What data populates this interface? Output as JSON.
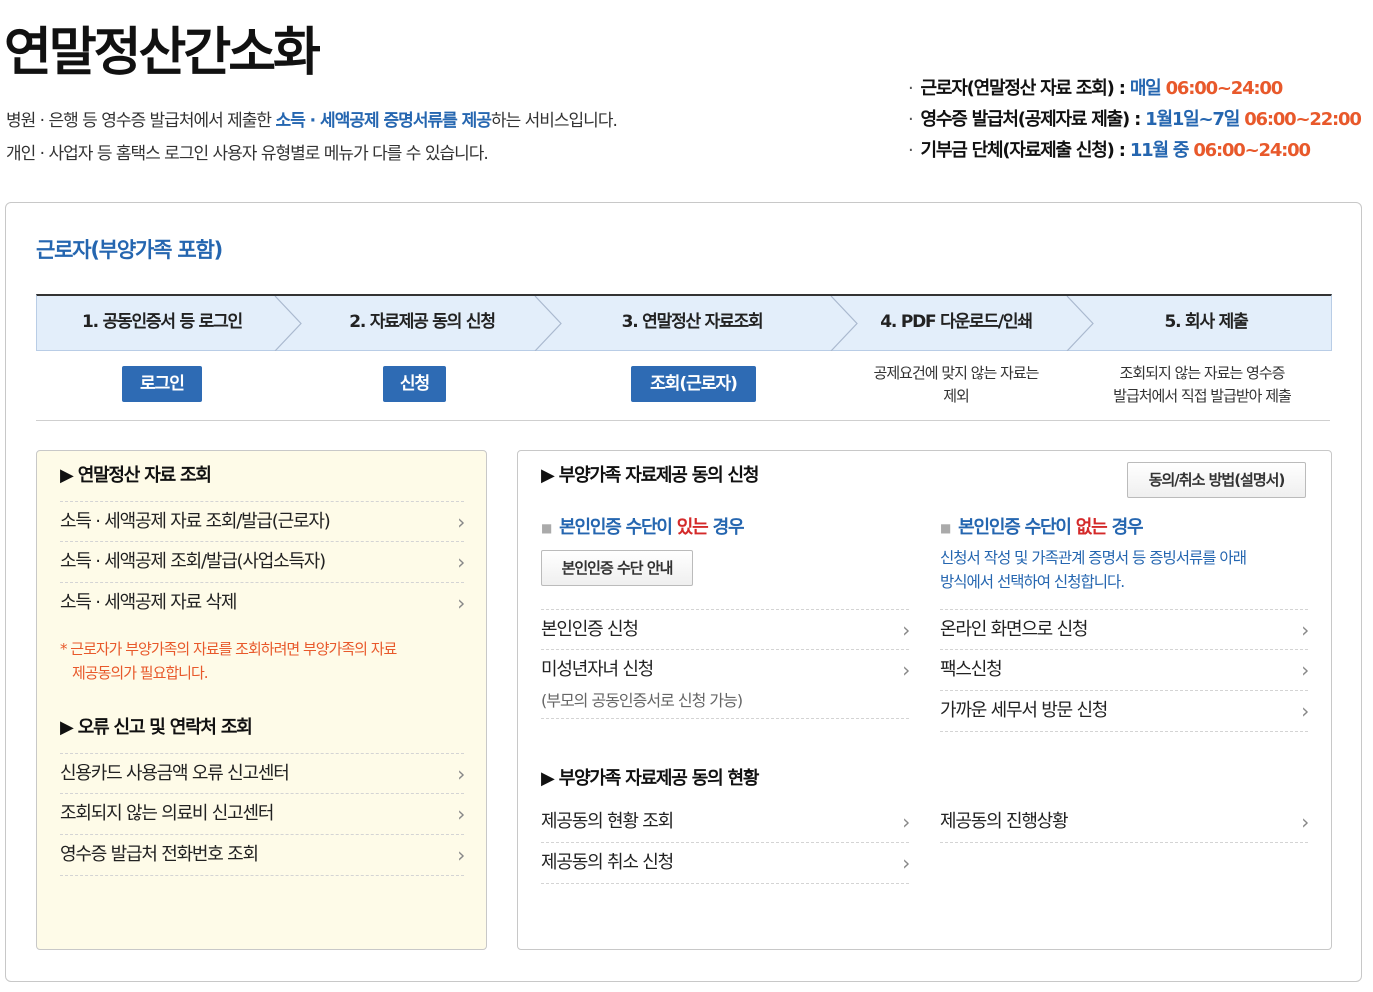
{
  "header": {
    "title": "연말정산간소화",
    "desc1_pre": "병원 · 은행 등 영수증 발급처에서 제출한 ",
    "desc1_hl": "소득 · 세액공제 증명서류를 제공",
    "desc1_post": "하는 서비스입니다.",
    "desc2": "개인 · 사업자 등 홈택스 로그인 사용자 유형별로 메뉴가 다를 수 있습니다."
  },
  "schedule": [
    {
      "label": "근로자(연말정산 자료 조회) : ",
      "period": "매일 ",
      "time": "06:00~24:00"
    },
    {
      "label": "영수증 발급처(공제자료 제출) : ",
      "period": "1월1일~7일 ",
      "time": "06:00~22:00"
    },
    {
      "label": "기부금 단체(자료제출 신청) : ",
      "period": "11월 중 ",
      "time": "06:00~24:00"
    }
  ],
  "panel": {
    "title": "근로자(부양가족 포함)",
    "steps": [
      "1. 공동인증서 등 로그인",
      "2. 자료제공 동의 신청",
      "3. 연말정산 자료조회",
      "4. PDF 다운로드/인쇄",
      "5. 회사 제출"
    ],
    "step_buttons": {
      "login": "로그인",
      "apply": "신청",
      "query": "조회(근로자)"
    },
    "step_notes": {
      "pdf": [
        "공제요건에 맞지 않는 자료는",
        "제외"
      ],
      "submit": [
        "조회되지 않는 자료는 영수증",
        "발급처에서 직접 발급받아 제출"
      ]
    }
  },
  "left": {
    "sec1_title": "▶ 연말정산 자료 조회",
    "sec1_items": [
      "소득 · 세액공제 자료 조회/발급(근로자)",
      "소득 · 세액공제 조회/발급(사업소득자)",
      "소득 · 세액공제 자료 삭제"
    ],
    "warning": [
      "* 근로자가 부양가족의 자료를 조회하려면 부양가족의 자료",
      "제공동의가 필요합니다."
    ],
    "sec2_title": "▶ 오류 신고 및 연락처 조회",
    "sec2_items": [
      "신용카드 사용금액 오류 신고센터",
      "조회되지 않는 의료비 신고센터",
      "영수증 발급처 전화번호 조회"
    ]
  },
  "right": {
    "sec1_title": "▶ 부양가족 자료제공 동의 신청",
    "guide_button": "동의/취소 방법(설명서)",
    "has_auth": {
      "pre": "본인인증 수단이 ",
      "hl": "있는",
      "post": " 경우",
      "button": "본인인증 수단 안내",
      "items": [
        "본인인증 신청",
        "미성년자녀 신청"
      ],
      "sub_note": "(부모의 공동인증서로 신청 가능)"
    },
    "no_auth": {
      "pre": "본인인증 수단이 ",
      "hl": "없는",
      "post": " 경우",
      "desc": [
        "신청서 작성 및 가족관계 증명서 등 증빙서류를 아래",
        "방식에서 선택하여 신청합니다."
      ],
      "items": [
        "온라인 화면으로 신청",
        "팩스신청",
        "가까운 세무서 방문 신청"
      ]
    },
    "sec2_title": "▶ 부양가족 자료제공 동의 현황",
    "status_left": [
      "제공동의 현황 조회",
      "제공동의 취소 신청"
    ],
    "status_right": [
      "제공동의 진행상황"
    ]
  },
  "colors": {
    "accent": "#2566b0",
    "orange": "#e8592b",
    "red": "#d42a2a",
    "step_bg": "#e3eefa",
    "button_blue": "#2e6bb4",
    "left_bg": "#fefbe8"
  },
  "icons": {
    "arrow": "chevron-right-icon",
    "step_divider": "step-chevron-icon",
    "square_bullet": "square-bullet-icon"
  }
}
